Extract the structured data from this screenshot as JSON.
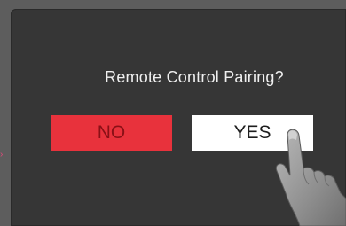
{
  "dialog": {
    "title": "Remote Control Pairing?",
    "no_label": "NO",
    "yes_label": "YES"
  },
  "colors": {
    "no_button": "#e8323c",
    "yes_button": "#ffffff",
    "screen": "#363636"
  },
  "icons": {
    "pointer": "pointing-hand-icon"
  }
}
